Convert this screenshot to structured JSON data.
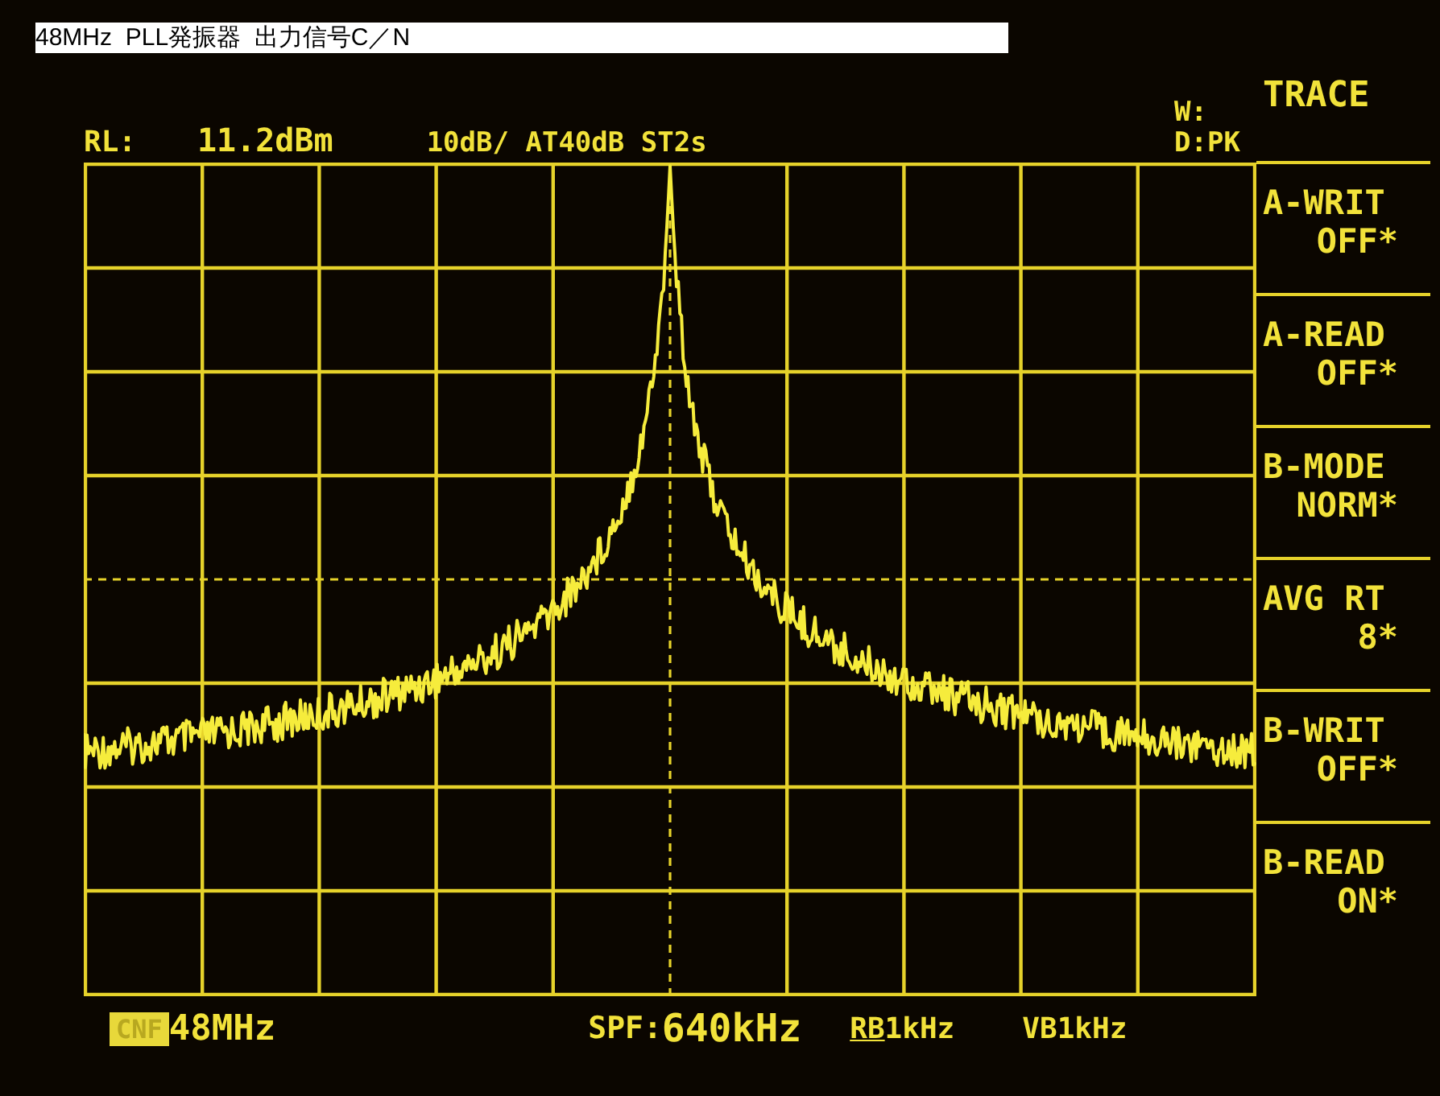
{
  "caption": "48MHz  PLL発振器  出力信号C／N",
  "header": {
    "rl_label": "RL:",
    "rl_value": "11.2dBm",
    "settings": "10dB/ AT40dB ST2s",
    "w_label": "W:",
    "d_label": "D:PK"
  },
  "menu": {
    "title": "TRACE",
    "items": [
      {
        "label": "A-WRIT",
        "value": "OFF*"
      },
      {
        "label": "A-READ",
        "value": "OFF*"
      },
      {
        "label": "B-MODE",
        "value": "NORM*"
      },
      {
        "label": "AVG RT",
        "value": "8*"
      },
      {
        "label": "B-WRIT",
        "value": "OFF*"
      },
      {
        "label": "B-READ",
        "value": "ON*"
      }
    ]
  },
  "footer": {
    "badge": "CNF",
    "center_freq": "48MHz",
    "span_label": "SPF:",
    "span_value": "640kHz",
    "rbw_label": "RB",
    "rbw_value": "1kHz",
    "vbw": "VB1kHz"
  }
}
